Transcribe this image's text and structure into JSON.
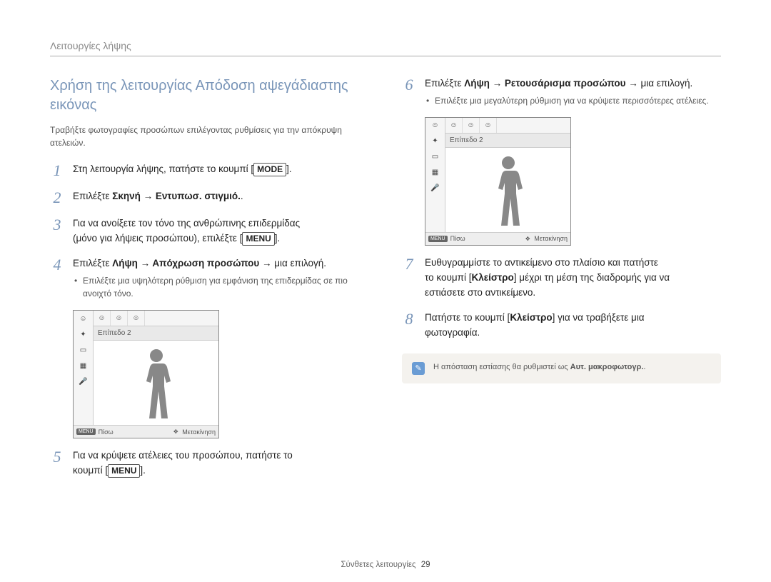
{
  "header": {
    "breadcrumb": "Λειτουργίες λήψης"
  },
  "section_title": "Χρήση της λειτουργίας Απόδοση αψεγάδιαστης εικόνας",
  "intro": "Τραβήξτε φωτογραφίες προσώπων επιλέγοντας ρυθμίσεις για την απόκρυψη ατελειών.",
  "steps": {
    "s1": {
      "num": "1",
      "pre": "Στη λειτουργία λήψης, πατήστε το κουμπί [",
      "key": "MODE",
      "post": "]."
    },
    "s2": {
      "num": "2",
      "text_pre": "Επιλέξτε ",
      "bold": "Σκηνή → Εντυπωσ. στιγμιό.",
      "text_post": "."
    },
    "s3": {
      "num": "3",
      "line1": "Για να ανοίξετε τον τόνο της ανθρώπινης επιδερμίδας",
      "line2_pre": "(μόνο για λήψεις προσώπου), επιλέξτε [",
      "key": "MENU",
      "line2_post": "]."
    },
    "s4": {
      "num": "4",
      "text_pre": "Επιλέξτε ",
      "bold": "Λήψη → Απόχρωση προσώπου →",
      "text_post": " μια επιλογή.",
      "bullet": "Επιλέξτε μια υψηλότερη ρύθμιση για εμφάνιση της επιδερμίδας σε πιο ανοιχτό τόνο."
    },
    "s5": {
      "num": "5",
      "line1": "Για να κρύψετε ατέλειες του προσώπου, πατήστε το",
      "line2_pre": "κουμπί [",
      "key": "MENU",
      "line2_post": "]."
    },
    "s6": {
      "num": "6",
      "text_pre": "Επιλέξτε ",
      "bold": "Λήψη → Ρετουσάρισμα προσώπου →",
      "text_post": " μια επιλογή.",
      "bullet": "Επιλέξτε μια μεγαλύτερη ρύθμιση για να κρύψετε περισσότερες ατέλειες."
    },
    "s7": {
      "num": "7",
      "l1": "Ευθυγραμμίστε το αντικείμενο στο πλαίσιο και πατήστε",
      "l2_pre": "το κουμπί [",
      "l2_bold": "Κλείστρο",
      "l2_mid": "] μέχρι τη μέση της διαδρομής για να",
      "l3": "εστιάσετε στο αντικείμενο."
    },
    "s8": {
      "num": "8",
      "l1_pre": "Πατήστε το κουμπί [",
      "l1_bold": "Κλείστρο",
      "l1_post": "] για να τραβήξετε μια",
      "l2": "φωτογραφία."
    }
  },
  "preview": {
    "level_label": "Επίπεδο 2",
    "back_badge": "MENU",
    "back_label": "Πίσω",
    "move_label": "Μετακίνηση"
  },
  "note": {
    "text_pre": "Η απόσταση εστίασης θα ρυθμιστεί ως ",
    "text_bold": "Αυτ. μακροφωτογρ.",
    "text_post": "."
  },
  "footer": {
    "label": "Σύνθετες λειτουργίες",
    "page_num": "29"
  }
}
